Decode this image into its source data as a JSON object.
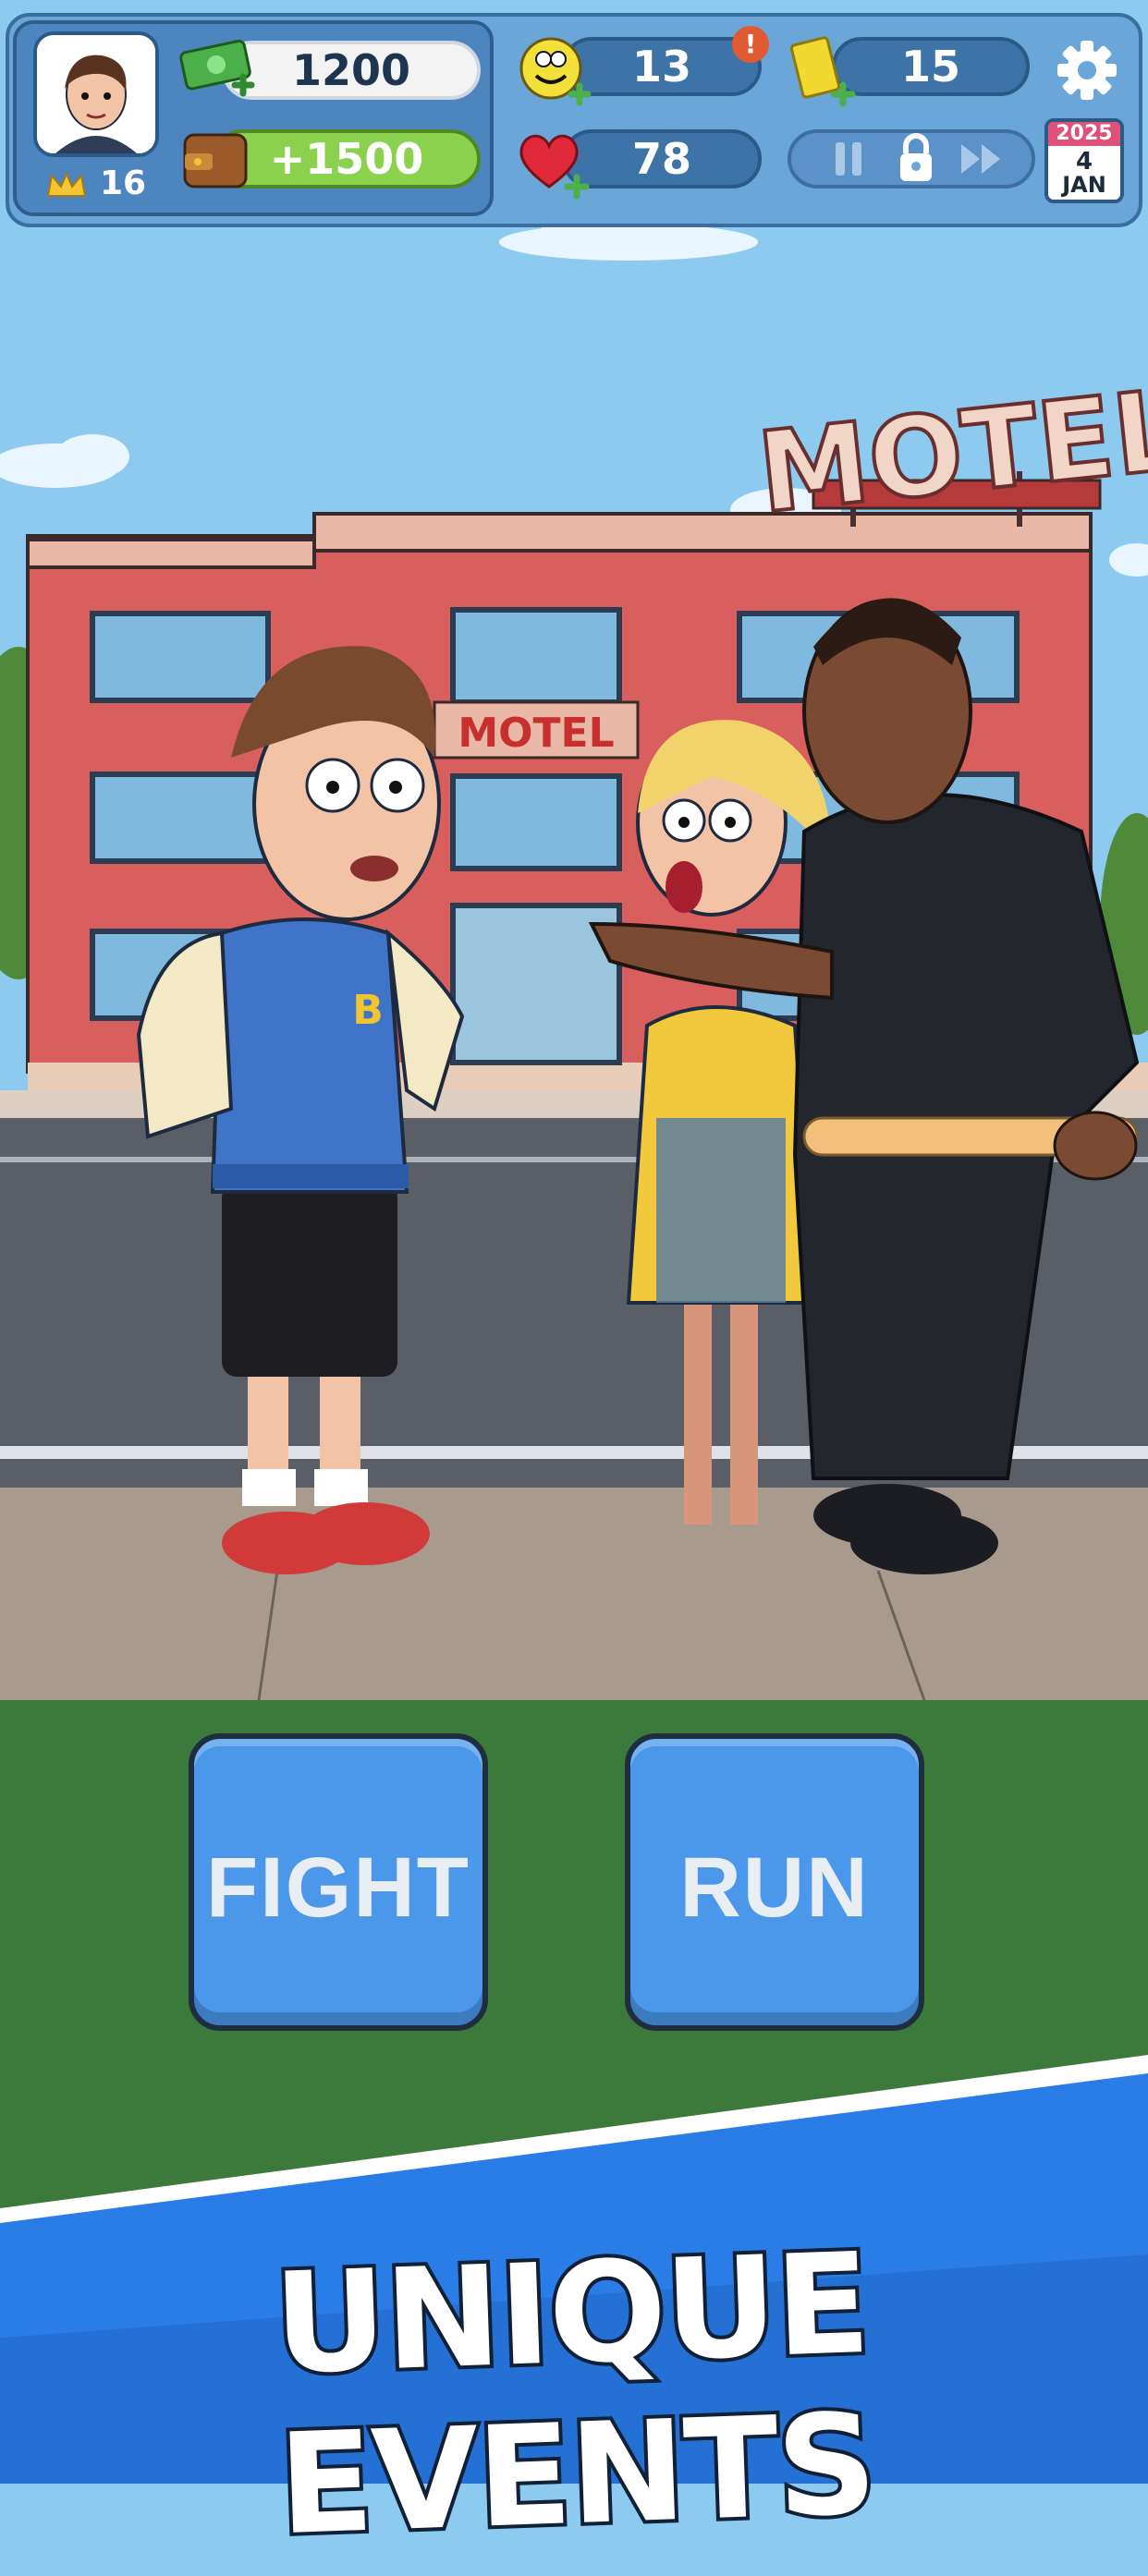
{
  "hud": {
    "player_level": "16",
    "cash": "1200",
    "wallet_bonus": "+1500",
    "happiness": "13",
    "happiness_alert": "!",
    "tickets": "15",
    "health": "78",
    "calendar": {
      "year": "2025",
      "day": "4",
      "month": "JAN"
    }
  },
  "scene": {
    "sign_rooftop": "MOTEL",
    "sign_facade": "MOTEL",
    "jacket_letter": "B"
  },
  "actions": {
    "fight_label": "FIGHT",
    "run_label": "RUN"
  },
  "banner": {
    "text": "UNIQUE EVENTS"
  },
  "colors": {
    "button_blue": "#4b97ea",
    "hud_blue": "#6aa6d8",
    "grass": "#3b7a3a",
    "banner_blue": "#2a7de6"
  }
}
